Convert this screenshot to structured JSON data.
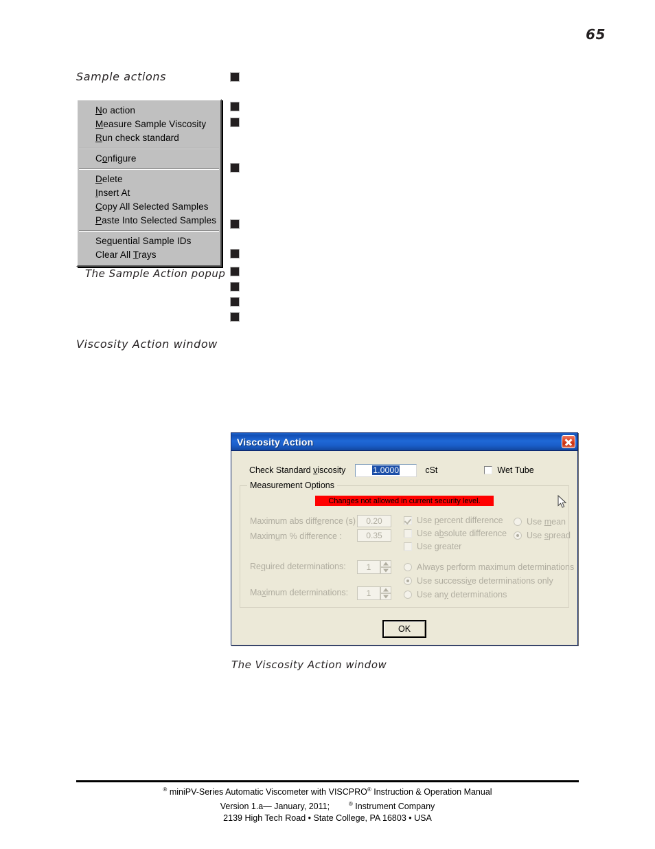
{
  "page": {
    "number": "65"
  },
  "headings": {
    "sample_actions": "Sample actions",
    "viscosity_action_window": "Viscosity Action window"
  },
  "captions": {
    "popup": "The Sample Action popup",
    "dialog": "The Viscosity Action window"
  },
  "bullets": {
    "marker": "square-bullet",
    "positions_y": [
      106,
      149,
      172,
      238,
      320,
      363,
      389,
      411,
      433,
      455
    ]
  },
  "popup_menu": {
    "name": "Sample Action popup",
    "groups": [
      {
        "items": [
          {
            "accel": "N",
            "rest": "o action"
          },
          {
            "accel": "M",
            "rest": "easure Sample Viscosity"
          },
          {
            "accel": "R",
            "rest": "un check standard"
          }
        ]
      },
      {
        "items": [
          {
            "pre": "C",
            "accel": "o",
            "rest": "nfigure"
          }
        ]
      },
      {
        "items": [
          {
            "accel": "D",
            "rest": "elete"
          },
          {
            "accel": "I",
            "rest": "nsert At"
          },
          {
            "accel": "C",
            "rest": "opy All Selected Samples"
          },
          {
            "accel": "P",
            "rest": "aste Into Selected Samples"
          }
        ]
      },
      {
        "items": [
          {
            "pre": "Se",
            "accel": "q",
            "rest": "uential Sample IDs"
          },
          {
            "pre": "Clear All ",
            "accel": "T",
            "rest": "rays"
          }
        ]
      }
    ]
  },
  "dialog": {
    "title": "Viscosity Action",
    "close_icon": "close-icon",
    "check_standard": {
      "label_pre": "Check Standard ",
      "label_accel": "v",
      "label_rest": "iscosity",
      "value": "1.0000",
      "unit": "cSt"
    },
    "wet_tube": {
      "label": "Wet Tube",
      "checked": false
    },
    "measurement_options": {
      "title": "Measurement Options",
      "security_banner": "Changes not allowed in current security level.",
      "max_abs_difference": {
        "label_pre": "Maximum abs diff",
        "label_accel": "e",
        "label_rest": "rence (s) :",
        "value": "0.20"
      },
      "max_pct_difference": {
        "label_pre": "Maxim",
        "label_accel": "u",
        "label_rest": "m % difference :",
        "value": "0.35"
      },
      "checkboxes": [
        {
          "pre": "Use ",
          "accel": "p",
          "rest": "ercent difference",
          "checked": true
        },
        {
          "pre": "Use a",
          "accel": "b",
          "rest": "solute difference",
          "checked": false
        },
        {
          "pre": "Use ",
          "accel": "g",
          "rest": "reater",
          "checked": false
        }
      ],
      "stat_radios": [
        {
          "pre": "Use ",
          "accel": "m",
          "rest": "ean",
          "selected": false
        },
        {
          "pre": "Use ",
          "accel": "s",
          "rest": "pread",
          "selected": true
        }
      ],
      "required_determinations": {
        "label_pre": "Re",
        "label_accel": "q",
        "label_rest": "uired determinations:",
        "value": "1"
      },
      "maximum_determinations": {
        "label_pre": "Ma",
        "label_accel": "x",
        "label_rest": "imum determinations:",
        "value": "1"
      },
      "determination_radios": [
        {
          "pre": "Always perform maximum determinations",
          "accel": "",
          "rest": "",
          "selected": false
        },
        {
          "pre": "Use successi",
          "accel": "v",
          "rest": "e determinations only",
          "selected": true
        },
        {
          "pre": "Use an",
          "accel": "y",
          "rest": " determinations",
          "selected": false
        }
      ]
    },
    "ok_button": "OK"
  },
  "footer": {
    "line1_pre": "miniPV-Series Automatic Viscometer with VISCPRO",
    "line1_post": " Instruction & Operation Manual",
    "line2_pre": "Version 1.a— January, 2011;",
    "line2_post": " Instrument Company",
    "line3": "2139 High Tech Road • State College, PA  16803 • USA"
  }
}
